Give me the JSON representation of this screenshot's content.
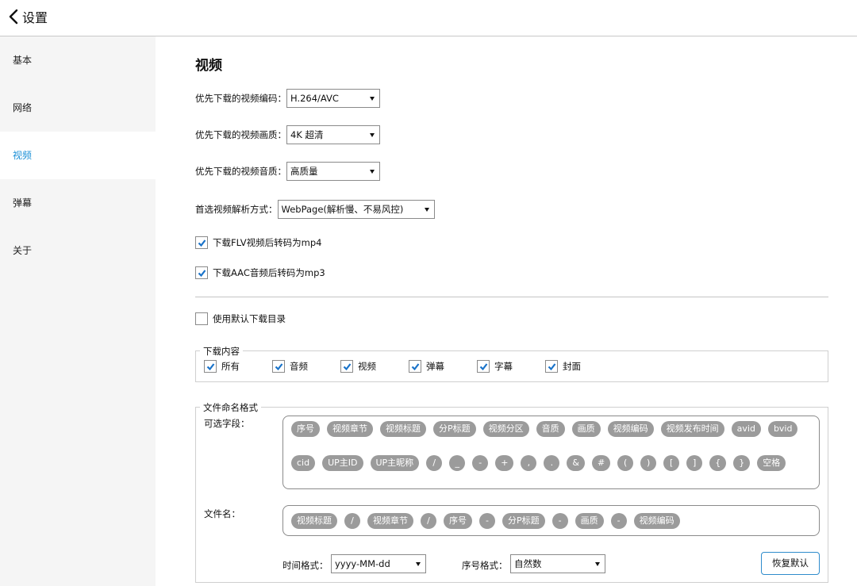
{
  "header": {
    "back_label": "设置"
  },
  "sidebar": {
    "items": [
      {
        "label": "基本"
      },
      {
        "label": "网络"
      },
      {
        "label": "视频"
      },
      {
        "label": "弹幕"
      },
      {
        "label": "关于"
      }
    ],
    "active_index": 2
  },
  "main": {
    "title": "视频",
    "codec": {
      "label": "优先下载的视频编码：",
      "value": "H.264/AVC"
    },
    "quality": {
      "label": "优先下载的视频画质：",
      "value": "4K 超清"
    },
    "audio": {
      "label": "优先下载的视频音质：",
      "value": "高质量"
    },
    "parse": {
      "label": "首选视频解析方式：",
      "value": "WebPage(解析慢、不易风控)"
    },
    "flv_to_mp4": {
      "label": "下载FLV视频后转码为mp4",
      "checked": true
    },
    "aac_to_mp3": {
      "label": "下载AAC音频后转码为mp3",
      "checked": true
    },
    "use_default_dir": {
      "label": "使用默认下载目录",
      "checked": false
    },
    "download_content": {
      "legend": "下载内容",
      "items": [
        {
          "label": "所有",
          "checked": true
        },
        {
          "label": "音频",
          "checked": true
        },
        {
          "label": "视频",
          "checked": true
        },
        {
          "label": "弹幕",
          "checked": true
        },
        {
          "label": "字幕",
          "checked": true
        },
        {
          "label": "封面",
          "checked": true
        }
      ]
    },
    "naming": {
      "legend": "文件命名格式",
      "optional_label": "可选字段：",
      "optional_fields": [
        "序号",
        "视频章节",
        "视频标题",
        "分P标题",
        "视频分区",
        "音质",
        "画质",
        "视频编码",
        "视频发布时间",
        "avid",
        "bvid",
        "cid",
        "UP主ID",
        "UP主昵称",
        "/",
        "_",
        "-",
        "+",
        ",",
        ".",
        "&",
        "#",
        "(",
        ")",
        "[",
        "]",
        "{",
        "}",
        "空格"
      ],
      "filename_label": "文件名：",
      "filename_fields": [
        "视频标题",
        "/",
        "视频章节",
        "/",
        "序号",
        "-",
        "分P标题",
        "-",
        "画质",
        "-",
        "视频编码"
      ],
      "time_format": {
        "label": "时间格式：",
        "value": "yyyy-MM-dd"
      },
      "index_format": {
        "label": "序号格式：",
        "value": "自然数"
      },
      "reset_label": "恢复默认"
    }
  },
  "colors": {
    "accent": "#1a8fd6",
    "pill": "#9b9b9b"
  }
}
